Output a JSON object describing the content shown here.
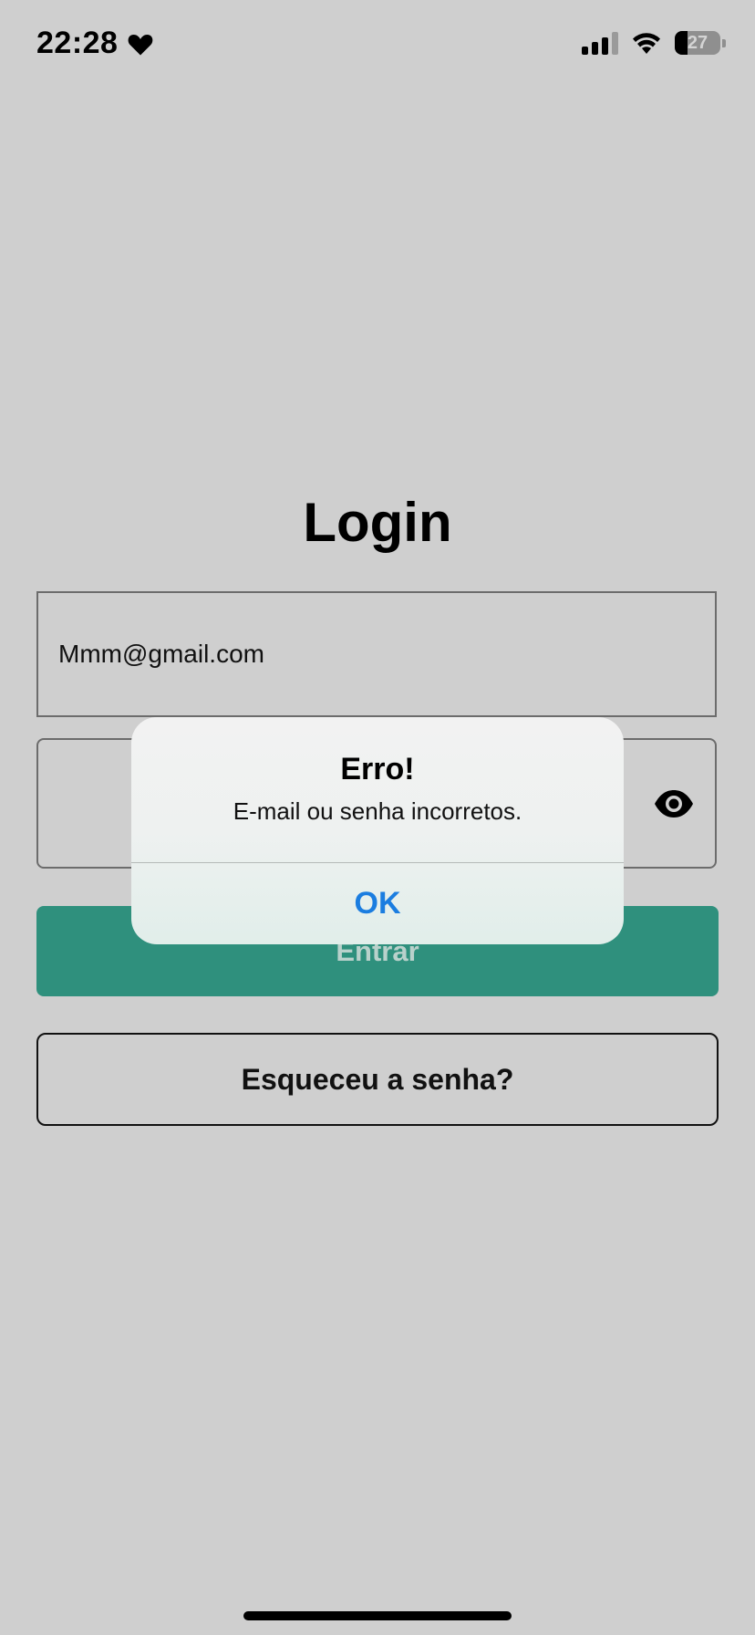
{
  "status_bar": {
    "time": "22:28",
    "battery_level": "27",
    "battery_fraction": 0.27,
    "icons": [
      "heart-icon",
      "signal-icon",
      "wifi-icon",
      "battery-icon"
    ]
  },
  "login": {
    "title": "Login",
    "email_value": "Mmm@gmail.com",
    "password_value": "",
    "submit_label": "Entrar",
    "forgot_label": "Esqueceu a senha?"
  },
  "alert": {
    "title": "Erro!",
    "message": "E-mail ou senha incorretos.",
    "ok_label": "OK"
  },
  "colors": {
    "background": "#cfcfcf",
    "primary": "#2f907d",
    "alert_action": "#1b7de0"
  }
}
